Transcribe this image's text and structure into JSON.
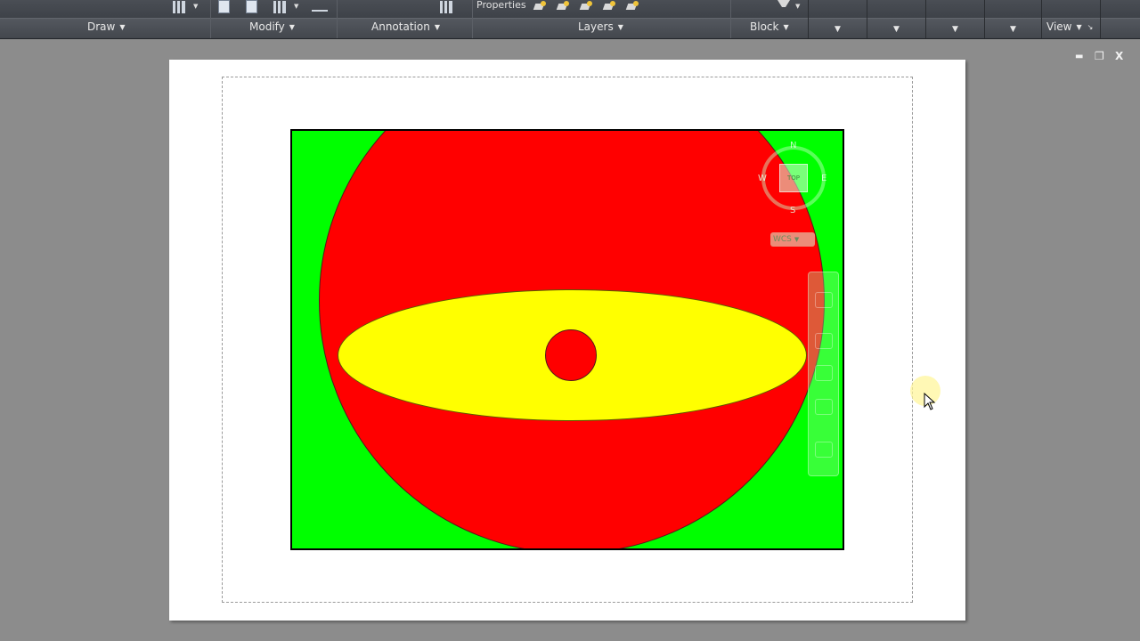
{
  "ribbon": {
    "properties_label": "Properties",
    "panels": [
      {
        "name": "draw",
        "label": "Draw"
      },
      {
        "name": "modify",
        "label": "Modify"
      },
      {
        "name": "annotation",
        "label": "Annotation"
      },
      {
        "name": "layers",
        "label": "Layers"
      },
      {
        "name": "block",
        "label": "Block"
      },
      {
        "name": "view",
        "label": "View"
      }
    ]
  },
  "window_controls": {
    "minimize": "▬",
    "restore": "❐",
    "close": "X"
  },
  "viewcube": {
    "face": "TOP",
    "north": "N",
    "south": "S",
    "east": "E",
    "west": "W"
  },
  "ucs": {
    "label": "WCS"
  },
  "drawing_colors": {
    "background": "#00ff00",
    "circles": "#ff0000",
    "ellipse": "#ffff00"
  }
}
